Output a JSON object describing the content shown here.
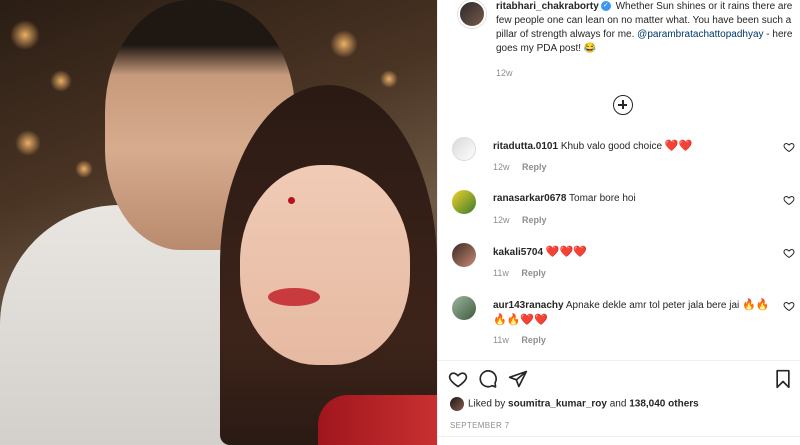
{
  "post": {
    "username": "ritabhari_chakraborty",
    "caption_pre": "Whether Sun shines or it rains there are few people one can lean on no matter what. You have been such a pillar of strength always for me.",
    "mention": "@parambratachattopadhyay",
    "caption_post": "- here goes my PDA post! 😂",
    "time": "12w"
  },
  "comments": [
    {
      "username": "ritadutta.0101",
      "text": "Khub valo good choice",
      "emoji": "❤️❤️",
      "time": "12w",
      "reply": "Reply"
    },
    {
      "username": "ranasarkar0678",
      "text": "Tomar bore hoi",
      "emoji": "",
      "time": "12w",
      "reply": "Reply"
    },
    {
      "username": "kakali5704",
      "text": "",
      "emoji": "❤️❤️❤️",
      "time": "11w",
      "reply": "Reply"
    },
    {
      "username": "aur143ranachy",
      "text": "Apnake dekle amr tol peter jala bere jai",
      "emoji": "🔥🔥🔥🔥❤️❤️",
      "time": "11w",
      "reply": "Reply"
    }
  ],
  "likes": {
    "prefix": "Liked by",
    "user": "soumitra_kumar_roy",
    "connector": "and",
    "count": "138,040 others"
  },
  "date": "SEPTEMBER 7",
  "icons": [
    "heart-icon",
    "comment-icon",
    "share-icon",
    "bookmark-icon",
    "plus-circle-icon",
    "verified-icon"
  ]
}
